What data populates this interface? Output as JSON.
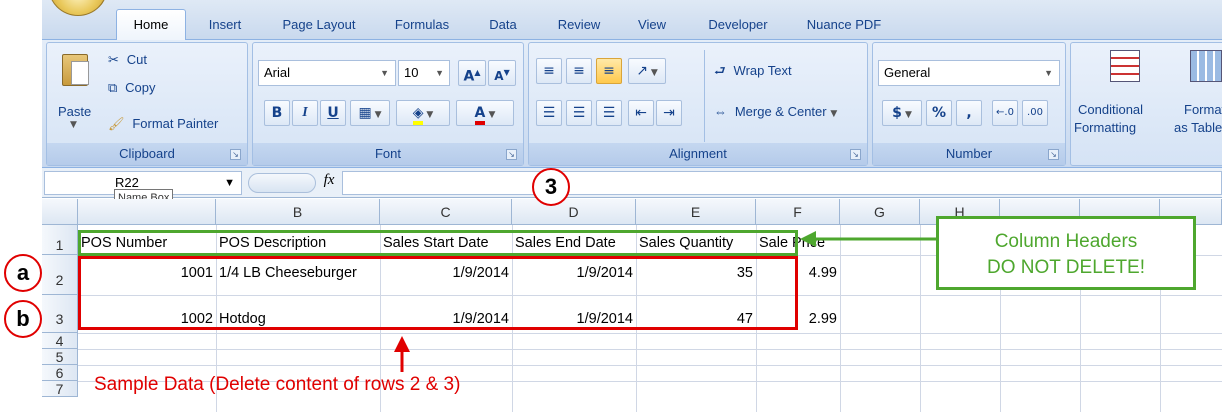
{
  "ribbon": {
    "tabs": [
      "Home",
      "Insert",
      "Page Layout",
      "Formulas",
      "Data",
      "Review",
      "View",
      "Developer",
      "Nuance PDF"
    ],
    "clipboard": {
      "paste": "Paste",
      "cut": "Cut",
      "copy": "Copy",
      "format_painter": "Format Painter",
      "group": "Clipboard"
    },
    "font": {
      "name": "Arial",
      "size": "10",
      "bold": "B",
      "italic": "I",
      "underline": "U",
      "font_color": "A",
      "group": "Font"
    },
    "alignment": {
      "wrap_text": "Wrap Text",
      "merge_center": "Merge & Center",
      "group": "Alignment"
    },
    "number": {
      "format": "General",
      "currency": "$",
      "percent": "%",
      "comma": ",",
      "group": "Number"
    },
    "styles": {
      "conditional_1": "Conditional",
      "conditional_2": "Formatting",
      "format_1": "Format",
      "format_2": "as Table"
    }
  },
  "formula_bar": {
    "name_box": "R22",
    "tooltip": "Name Box",
    "fx": "fx",
    "value": ""
  },
  "sheet": {
    "columns": [
      "B",
      "C",
      "D",
      "E",
      "F",
      "G",
      "H"
    ],
    "rows": [
      "1",
      "2",
      "3",
      "4",
      "5",
      "6",
      "7"
    ],
    "header_row": [
      "POS Number",
      "POS Description",
      "Sales Start Date",
      "Sales End Date",
      "Sales Quantity",
      "Sale Price"
    ],
    "data_rows": [
      [
        "1001",
        "1/4 LB Cheeseburger",
        "1/9/2014",
        "1/9/2014",
        "35",
        "4.99"
      ],
      [
        "1002",
        "Hotdog",
        "1/9/2014",
        "1/9/2014",
        "47",
        "2.99"
      ]
    ]
  },
  "annotations": {
    "callout_3": "3",
    "callout_a": "a",
    "callout_b": "b",
    "column_headers_line1": "Column Headers",
    "column_headers_line2": "DO NOT DELETE!",
    "sample_data": "Sample Data (Delete content of rows 2 & 3)",
    "colors": {
      "red": "#e00000",
      "green": "#4ea72e",
      "ribbon_text": "#15428b"
    }
  }
}
